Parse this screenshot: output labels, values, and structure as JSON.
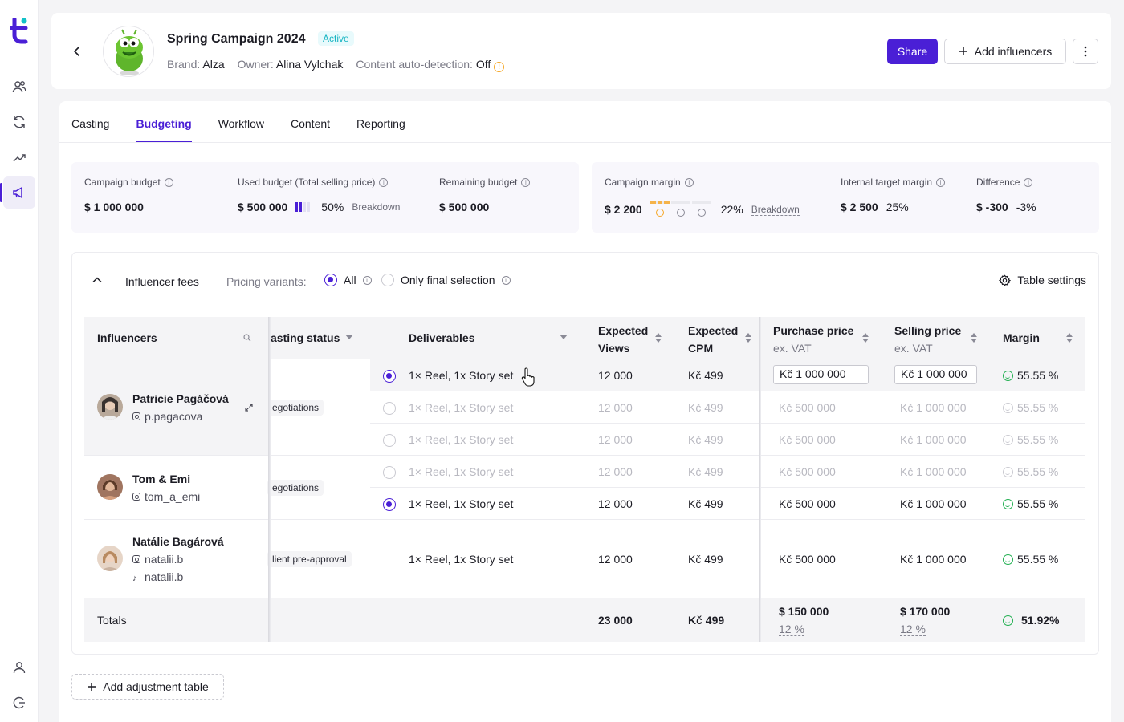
{
  "campaign": {
    "title": "Spring Campaign 2024",
    "status": "Active",
    "brand_label": "Brand:",
    "brand": "Alza",
    "owner_label": "Owner:",
    "owner": "Alina Vylchak",
    "autodetect_label": "Content auto-detection:",
    "autodetect": "Off"
  },
  "actions": {
    "share": "Share",
    "add_influencers": "Add influencers"
  },
  "tabs": [
    "Casting",
    "Budgeting",
    "Workflow",
    "Content",
    "Reporting"
  ],
  "active_tab": "Budgeting",
  "budget": {
    "campaign_budget_label": "Campaign budget",
    "campaign_budget": "$ 1 000 000",
    "used_label": "Used budget (Total selling price)",
    "used": "$ 500 000",
    "used_pct": "50%",
    "used_progress": 0.5,
    "breakdown": "Breakdown",
    "remaining_label": "Remaining budget",
    "remaining": "$ 500 000"
  },
  "margin": {
    "campaign_margin_label": "Campaign margin",
    "campaign_margin": "$ 2 200",
    "campaign_margin_pct": "22%",
    "breakdown": "Breakdown",
    "target_label": "Internal target margin",
    "target": "$ 2 500",
    "target_pct": "25%",
    "difference_label": "Difference",
    "difference": "$ -300",
    "difference_pct": "-3%"
  },
  "fees": {
    "title": "Influencer fees",
    "pricing_variants_label": "Pricing variants:",
    "option_all": "All",
    "option_final": "Only final selection",
    "table_settings": "Table settings"
  },
  "columns": {
    "influencers": "Influencers",
    "casting_status": "asting status",
    "deliverables": "Deliverables",
    "expected_views_1": "Expected",
    "expected_views_2": "Views",
    "expected_cpm_1": "Expected",
    "expected_cpm_2": "CPM",
    "purchase_1": "Purchase price",
    "purchase_2": "ex. VAT",
    "selling_1": "Selling price",
    "selling_2": "ex. VAT",
    "margin": "Margin"
  },
  "influencers": [
    {
      "name": "Patricie Pagáčová",
      "instagram": "p.pagacova",
      "status": "egotiations"
    },
    {
      "name": "Tom & Emi",
      "instagram": "tom_a_emi",
      "status": "egotiations"
    },
    {
      "name": "Natálie Bagárová",
      "instagram": "natalii.b",
      "tiktok": "natalii.b",
      "status": "lient pre-approval"
    }
  ],
  "rows": [
    {
      "deliverable": "1× Reel, 1x Story set",
      "views": "12 000",
      "cpm": "Kč 499",
      "purchase": "Kč 1 000 000",
      "selling": "Kč 1 000 000",
      "margin": "55.55 %"
    },
    {
      "deliverable": "1× Reel, 1x Story set",
      "views": "12 000",
      "cpm": "Kč 499",
      "purchase": "Kč 500 000",
      "selling": "Kč 1 000 000",
      "margin": "55.55 %"
    },
    {
      "deliverable": "1× Reel, 1x Story set",
      "views": "12 000",
      "cpm": "Kč 499",
      "purchase": "Kč 500 000",
      "selling": "Kč 1 000 000",
      "margin": "55.55 %"
    },
    {
      "deliverable": "1× Reel, 1x Story set",
      "views": "12 000",
      "cpm": "Kč 499",
      "purchase": "Kč 500 000",
      "selling": "Kč 1 000 000",
      "margin": "55.55 %"
    },
    {
      "deliverable": "1× Reel, 1x Story set",
      "views": "12 000",
      "cpm": "Kč 499",
      "purchase": "Kč 500 000",
      "selling": "Kč 1 000 000",
      "margin": "55.55 %"
    },
    {
      "deliverable": "1× Reel, 1x Story set",
      "views": "12 000",
      "cpm": "Kč 499",
      "purchase": "Kč 500 000",
      "selling": "Kč 1 000 000",
      "margin": "55.55 %"
    }
  ],
  "totals": {
    "label": "Totals",
    "views": "23 000",
    "cpm": "Kč 499",
    "purchase": "$ 150 000",
    "purchase_pct": "12 %",
    "selling": "$ 170 000",
    "selling_pct": "12 %",
    "margin": "51.92%"
  },
  "add_adjustment": "Add adjustment table",
  "colors": {
    "accent": "#4a1fd6",
    "active_badge": "#12b3c1",
    "positive": "#1fae4f",
    "warning": "#f5a623"
  }
}
